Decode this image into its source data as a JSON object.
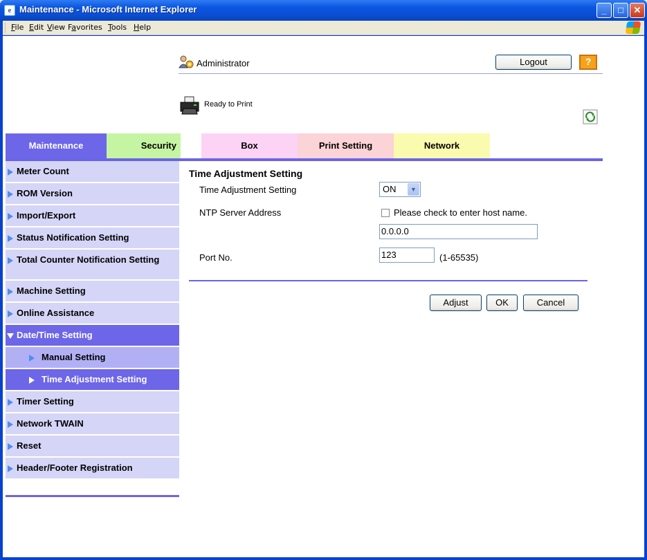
{
  "window": {
    "title": "Maintenance - Microsoft Internet Explorer",
    "minimize": "_",
    "maximize": "□",
    "close": "✕"
  },
  "menu": [
    "File",
    "Edit",
    "View",
    "Favorites",
    "Tools",
    "Help"
  ],
  "header": {
    "user": "Administrator",
    "logout": "Logout",
    "help": "?",
    "status": "Ready to Print"
  },
  "tabs": [
    {
      "label": "Maintenance",
      "color": "#6d66e8",
      "text_color": "#ffffff"
    },
    {
      "label": "Security",
      "color": "#c5f5a2",
      "text_color": "#000000"
    },
    {
      "label": "Box",
      "color": "#fcd3f4",
      "text_color": "#000000"
    },
    {
      "label": "Print Setting",
      "color": "#fcd3d6",
      "text_color": "#000000"
    },
    {
      "label": "Network",
      "color": "#fbfbb0",
      "text_color": "#000000"
    }
  ],
  "sidebar": [
    {
      "label": "Meter Count"
    },
    {
      "label": "ROM Version"
    },
    {
      "label": "Import/Export"
    },
    {
      "label": "Status Notification Setting"
    },
    {
      "label": "Total Counter Notification Setting"
    },
    {
      "label": "Machine Setting"
    },
    {
      "label": "Online Assistance"
    },
    {
      "label": "Date/Time Setting"
    },
    {
      "label": "Manual Setting"
    },
    {
      "label": "Time Adjustment Setting"
    },
    {
      "label": "Timer Setting"
    },
    {
      "label": "Network TWAIN"
    },
    {
      "label": "Reset"
    },
    {
      "label": "Header/Footer Registration"
    }
  ],
  "form": {
    "title": "Time Adjustment Setting",
    "time_adjust_label": "Time Adjustment Setting",
    "time_adjust_value": "ON",
    "ntp_label": "NTP Server Address",
    "host_checkbox_label": "Please check to enter host name.",
    "host_checked": false,
    "ntp_value": "0.0.0.0",
    "port_label": "Port No.",
    "port_value": "123",
    "port_range": "(1-65535)",
    "adjust": "Adjust",
    "ok": "OK",
    "cancel": "Cancel"
  }
}
